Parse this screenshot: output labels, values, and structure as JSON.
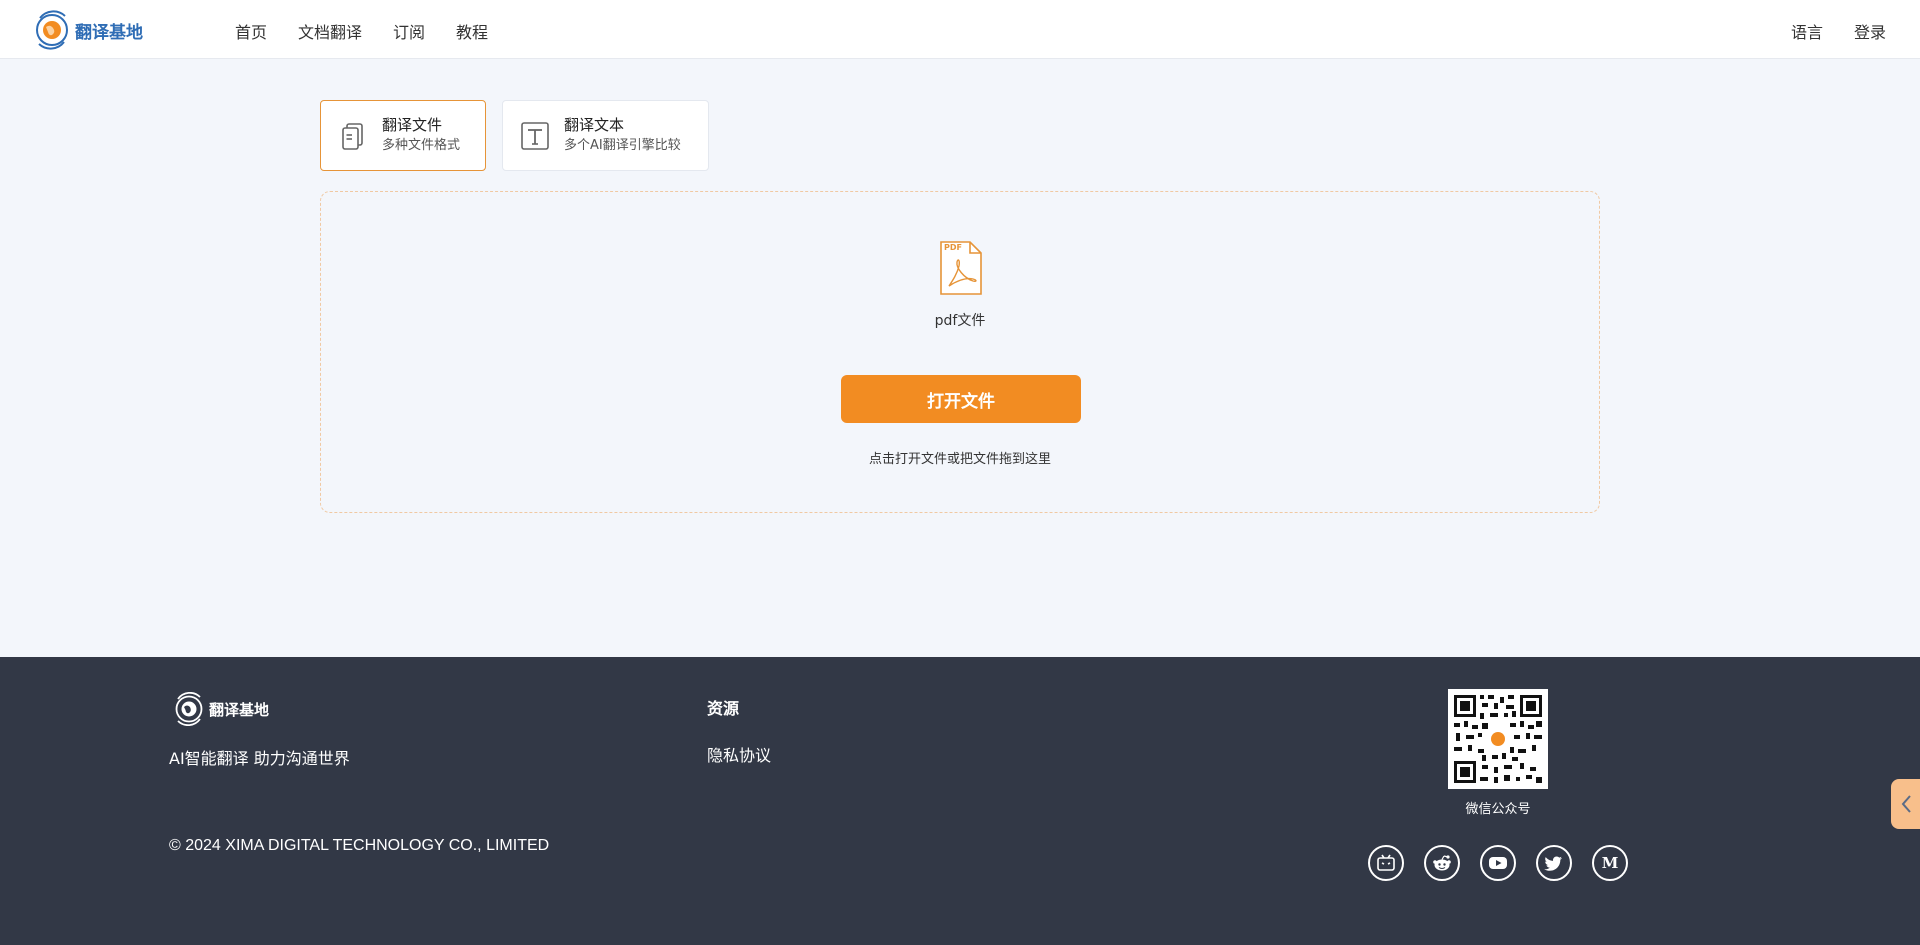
{
  "header": {
    "logo_text": "翻译基地",
    "nav": [
      "首页",
      "文档翻译",
      "订阅",
      "教程"
    ],
    "language": "语言",
    "login": "登录"
  },
  "tabs": [
    {
      "title": "翻译文件",
      "subtitle": "多种文件格式"
    },
    {
      "title": "翻译文本",
      "subtitle": "多个AI翻译引擎比较"
    }
  ],
  "upload": {
    "pdf_badge": "PDF",
    "file_type_label": "pdf文件",
    "open_button": "打开文件",
    "hint": "点击打开文件或把文件拖到这里"
  },
  "footer": {
    "logo_text": "翻译基地",
    "slogan": "AI智能翻译 助力沟通世界",
    "copyright": "© 2024 XIMA DIGITAL TECHNOLOGY CO., LIMITED",
    "resources_title": "资源",
    "privacy": "隐私协议",
    "qr_label": "微信公众号",
    "social_icons": [
      "bilibili-icon",
      "reddit-icon",
      "youtube-icon",
      "twitter-icon",
      "medium-icon"
    ]
  },
  "colors": {
    "accent": "#f28c22",
    "footer_bg": "#323846",
    "brand_blue": "#2f6db5",
    "page_bg": "#f3f6fb"
  }
}
